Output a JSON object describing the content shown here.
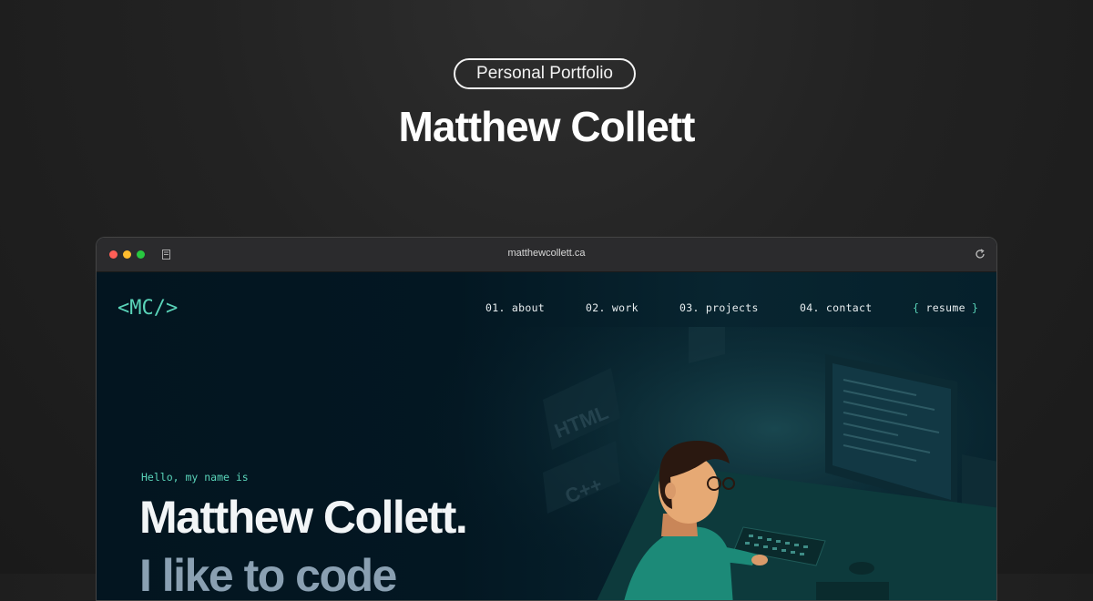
{
  "badge": "Personal Portfolio",
  "headline": "Matthew Collett",
  "browser": {
    "url": "matthewcollett.ca"
  },
  "site": {
    "logo": "<MC/>",
    "nav": [
      {
        "label": "01. about"
      },
      {
        "label": "02. work"
      },
      {
        "label": "03. projects"
      },
      {
        "label": "04. contact"
      }
    ],
    "resume": {
      "open": "{",
      "label": "resume",
      "close": "}"
    },
    "greeting": "Hello, my name is",
    "name": "Matthew Collett.",
    "tagline": "I like to code"
  },
  "illustration": {
    "labels": [
      "HTML",
      "C++"
    ]
  },
  "colors": {
    "accent": "#5ad4b9",
    "site_bg": "#02141f"
  }
}
